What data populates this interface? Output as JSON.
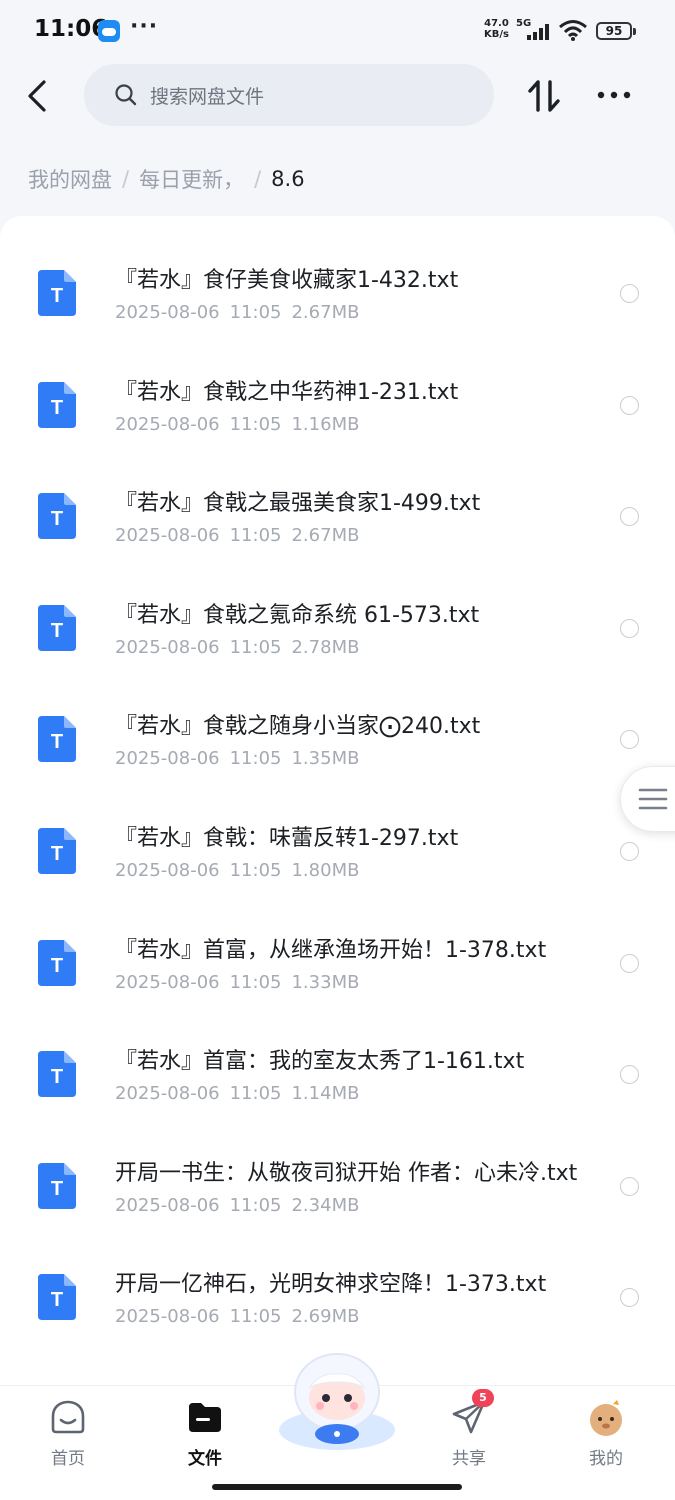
{
  "status_bar": {
    "time": "11:06",
    "dots": "···",
    "net_speed_value": "47.0",
    "net_speed_unit": "KB/s",
    "network_type": "5G",
    "battery": "95"
  },
  "search": {
    "placeholder": "搜索网盘文件"
  },
  "breadcrumb": {
    "items": [
      "我的网盘",
      "每日更新，"
    ],
    "separator": "/",
    "current": "8.6"
  },
  "files": [
    {
      "name": "『若水』食仔美食收藏家1-432.txt",
      "date": "2025-08-06",
      "time": "11:05",
      "size": "2.67MB"
    },
    {
      "name": "『若水』食戟之中华药神1-231.txt",
      "date": "2025-08-06",
      "time": "11:05",
      "size": "1.16MB"
    },
    {
      "name": "『若水』食戟之最强美食家1-499.txt",
      "date": "2025-08-06",
      "time": "11:05",
      "size": "2.67MB"
    },
    {
      "name": "『若水』食戟之氪命系统 61-573.txt",
      "date": "2025-08-06",
      "time": "11:05",
      "size": "2.78MB"
    },
    {
      "name": "『若水』食戟之随身小当家⨀240.txt",
      "date": "2025-08-06",
      "time": "11:05",
      "size": "1.35MB"
    },
    {
      "name": "『若水』食戟：味蕾反转1-297.txt",
      "date": "2025-08-06",
      "time": "11:05",
      "size": "1.80MB"
    },
    {
      "name": "『若水』首富，从继承渔场开始！1-378.txt",
      "date": "2025-08-06",
      "time": "11:05",
      "size": "1.33MB"
    },
    {
      "name": "『若水』首富：我的室友太秀了1-161.txt",
      "date": "2025-08-06",
      "time": "11:05",
      "size": "1.14MB"
    },
    {
      "name": "开局一书生：从敬夜司狱开始 作者：心未冷.txt",
      "date": "2025-08-06",
      "time": "11:05",
      "size": "2.34MB"
    },
    {
      "name": "开局一亿神石，光明女神求空降！1-373.txt",
      "date": "2025-08-06",
      "time": "11:05",
      "size": "2.69MB"
    }
  ],
  "file_icon_letter": "T",
  "nav": {
    "home": "首页",
    "files": "文件",
    "share": "共享",
    "share_badge": "5",
    "mine": "我的"
  },
  "colors": {
    "accent": "#2f7cf6",
    "badge": "#f0435a",
    "search_bg": "#e9ecf2"
  }
}
